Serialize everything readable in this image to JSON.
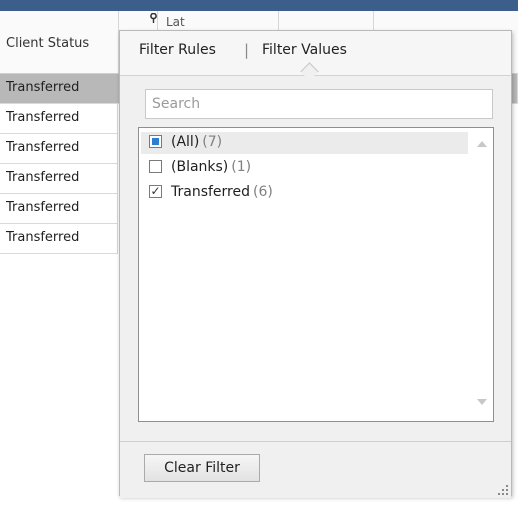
{
  "grid": {
    "columns": [
      {
        "label": "Client Status"
      },
      {
        "label": "Lat"
      }
    ],
    "rows": [
      {
        "client_status": "Transferred",
        "selected": true
      },
      {
        "client_status": "Transferred"
      },
      {
        "client_status": "Transferred"
      },
      {
        "client_status": "Transferred"
      },
      {
        "client_status": "Transferred"
      },
      {
        "client_status": "Transferred"
      }
    ]
  },
  "filter_popup": {
    "tabs": [
      {
        "label": "Filter Rules",
        "active": false
      },
      {
        "label": "Filter Values",
        "active": true
      }
    ],
    "search": {
      "placeholder": "Search",
      "value": ""
    },
    "values": [
      {
        "label": "(All)",
        "count": "(7)",
        "state": "indeterminate"
      },
      {
        "label": "(Blanks)",
        "count": "(1)",
        "state": "unchecked"
      },
      {
        "label": "Transferred",
        "count": "(6)",
        "state": "checked"
      }
    ],
    "clear_button": "Clear Filter"
  },
  "colors": {
    "title_bar": "#3b5f8a",
    "selected_row": "#b8b8b8",
    "all_checkbox_fill": "#2d7fd0"
  }
}
